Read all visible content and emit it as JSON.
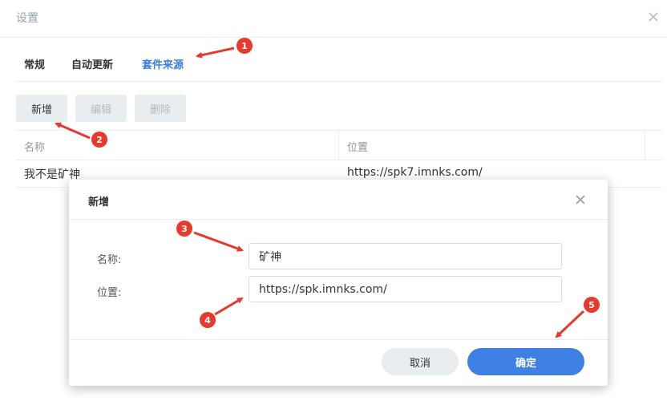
{
  "window": {
    "title": "设置",
    "close_icon": "close-icon"
  },
  "tabs": [
    {
      "label": "常规",
      "active": false
    },
    {
      "label": "自动更新",
      "active": false
    },
    {
      "label": "套件来源",
      "active": true
    }
  ],
  "toolbar": {
    "add_label": "新增",
    "edit_label": "编辑",
    "delete_label": "删除",
    "edit_enabled": false,
    "delete_enabled": false
  },
  "grid": {
    "columns": [
      "名称",
      "位置"
    ],
    "rows": [
      {
        "name": "我不是矿神",
        "location": "https://spk7.imnks.com/"
      }
    ]
  },
  "dialog": {
    "title": "新增",
    "name_label": "名称:",
    "name_value": "矿神",
    "location_label": "位置:",
    "location_value": "https://spk.imnks.com/",
    "cancel_label": "取消",
    "ok_label": "确定"
  },
  "annotations": {
    "labels": [
      "1",
      "2",
      "3",
      "4",
      "5"
    ],
    "color": "#e8392d"
  },
  "colors": {
    "accent": "#3e80e3",
    "tab_active": "#3a7de0",
    "button_bg": "#e9edf0",
    "divider": "#ebeef1"
  }
}
